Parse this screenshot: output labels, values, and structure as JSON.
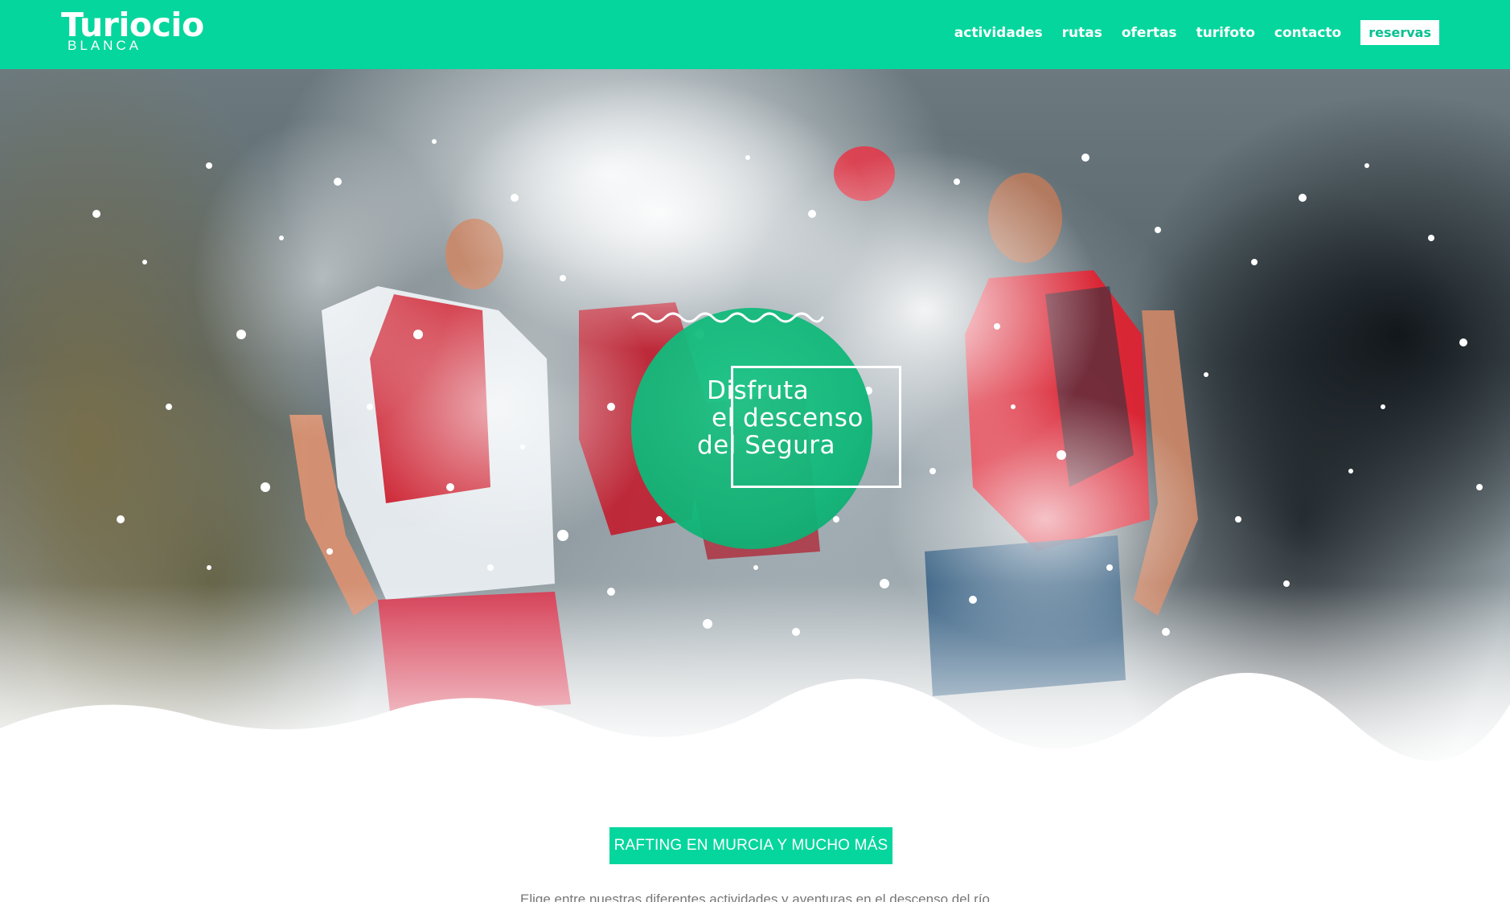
{
  "header": {
    "logo_main": "Turiocio",
    "logo_sub": "BLANCA",
    "nav": [
      {
        "label": "actividades"
      },
      {
        "label": "rutas"
      },
      {
        "label": "ofertas"
      },
      {
        "label": "turifoto"
      },
      {
        "label": "contacto"
      }
    ],
    "cta_label": "reservas"
  },
  "hero": {
    "photo": "rafting group under a splashing waterfall",
    "emblem": {
      "lines": [
        "Disfruta",
        "el descenso",
        "del Segura"
      ]
    }
  },
  "content": {
    "tagline": "RAFTING EN MURCIA Y MUCHO MÁS",
    "intro": "Elige entre nuestras diferentes actividades y aventuras en el descenso del río"
  },
  "colors": {
    "brand": "#05d69d",
    "emblem": "#10b779",
    "cta_text": "#05c190"
  }
}
